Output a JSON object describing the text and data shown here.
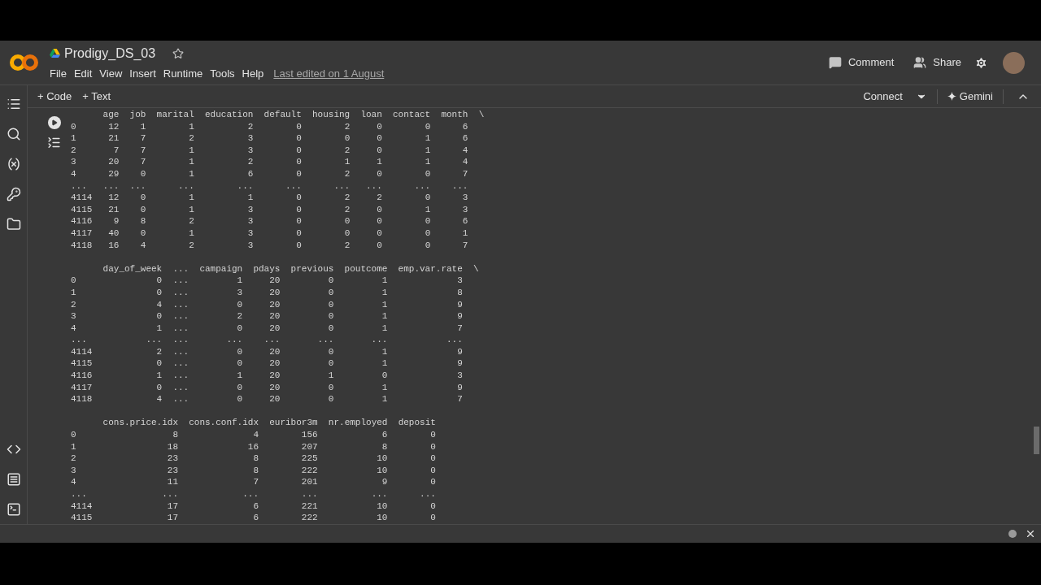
{
  "notebook": {
    "title": "Prodigy_DS_03",
    "starred": false,
    "menu": [
      "File",
      "Edit",
      "View",
      "Insert",
      "Runtime",
      "Tools",
      "Help"
    ],
    "last_edited": "Last edited on 1 August"
  },
  "header_actions": {
    "comment": "Comment",
    "share": "Share"
  },
  "toolbar": {
    "add_code": "+ Code",
    "add_text": "+ Text",
    "connect": "Connect",
    "gemini": "Gemini"
  },
  "output": {
    "blocks": [
      {
        "columns": [
          "",
          "age",
          "job",
          "marital",
          "education",
          "default",
          "housing",
          "loan",
          "contact",
          "month"
        ],
        "continued": "\\",
        "rows": [
          [
            "0",
            "12",
            "1",
            "1",
            "2",
            "0",
            "2",
            "0",
            "0",
            "6"
          ],
          [
            "1",
            "21",
            "7",
            "2",
            "3",
            "0",
            "0",
            "0",
            "1",
            "6"
          ],
          [
            "2",
            "7",
            "7",
            "1",
            "3",
            "0",
            "2",
            "0",
            "1",
            "4"
          ],
          [
            "3",
            "20",
            "7",
            "1",
            "2",
            "0",
            "1",
            "1",
            "1",
            "4"
          ],
          [
            "4",
            "29",
            "0",
            "1",
            "6",
            "0",
            "2",
            "0",
            "0",
            "7"
          ],
          [
            "...",
            "...",
            "...",
            "...",
            "...",
            "...",
            "...",
            "...",
            "...",
            "..."
          ],
          [
            "4114",
            "12",
            "0",
            "1",
            "1",
            "0",
            "2",
            "2",
            "0",
            "3"
          ],
          [
            "4115",
            "21",
            "0",
            "1",
            "3",
            "0",
            "2",
            "0",
            "1",
            "3"
          ],
          [
            "4116",
            "9",
            "8",
            "2",
            "3",
            "0",
            "0",
            "0",
            "0",
            "6"
          ],
          [
            "4117",
            "40",
            "0",
            "1",
            "3",
            "0",
            "0",
            "0",
            "0",
            "1"
          ],
          [
            "4118",
            "16",
            "4",
            "2",
            "3",
            "0",
            "2",
            "0",
            "0",
            "7"
          ]
        ]
      },
      {
        "columns": [
          "",
          "day_of_week",
          "...",
          "campaign",
          "pdays",
          "previous",
          "poutcome",
          "emp.var.rate"
        ],
        "continued": "\\",
        "rows": [
          [
            "0",
            "0",
            "...",
            "1",
            "20",
            "0",
            "1",
            "3"
          ],
          [
            "1",
            "0",
            "...",
            "3",
            "20",
            "0",
            "1",
            "8"
          ],
          [
            "2",
            "4",
            "...",
            "0",
            "20",
            "0",
            "1",
            "9"
          ],
          [
            "3",
            "0",
            "...",
            "2",
            "20",
            "0",
            "1",
            "9"
          ],
          [
            "4",
            "1",
            "...",
            "0",
            "20",
            "0",
            "1",
            "7"
          ],
          [
            "...",
            "...",
            "...",
            "...",
            "...",
            "...",
            "...",
            "..."
          ],
          [
            "4114",
            "2",
            "...",
            "0",
            "20",
            "0",
            "1",
            "9"
          ],
          [
            "4115",
            "0",
            "...",
            "0",
            "20",
            "0",
            "1",
            "9"
          ],
          [
            "4116",
            "1",
            "...",
            "1",
            "20",
            "1",
            "0",
            "3"
          ],
          [
            "4117",
            "0",
            "...",
            "0",
            "20",
            "0",
            "1",
            "9"
          ],
          [
            "4118",
            "4",
            "...",
            "0",
            "20",
            "0",
            "1",
            "7"
          ]
        ]
      },
      {
        "columns": [
          "",
          "cons.price.idx",
          "cons.conf.idx",
          "euribor3m",
          "nr.employed",
          "deposit"
        ],
        "rows": [
          [
            "0",
            "8",
            "4",
            "156",
            "6",
            "0"
          ],
          [
            "1",
            "18",
            "16",
            "207",
            "8",
            "0"
          ],
          [
            "2",
            "23",
            "8",
            "225",
            "10",
            "0"
          ],
          [
            "3",
            "23",
            "8",
            "222",
            "10",
            "0"
          ],
          [
            "4",
            "11",
            "7",
            "201",
            "9",
            "0"
          ],
          [
            "...",
            "...",
            "...",
            "...",
            "...",
            "..."
          ],
          [
            "4114",
            "17",
            "6",
            "221",
            "10",
            "0"
          ],
          [
            "4115",
            "17",
            "6",
            "222",
            "10",
            "0"
          ]
        ]
      }
    ]
  }
}
